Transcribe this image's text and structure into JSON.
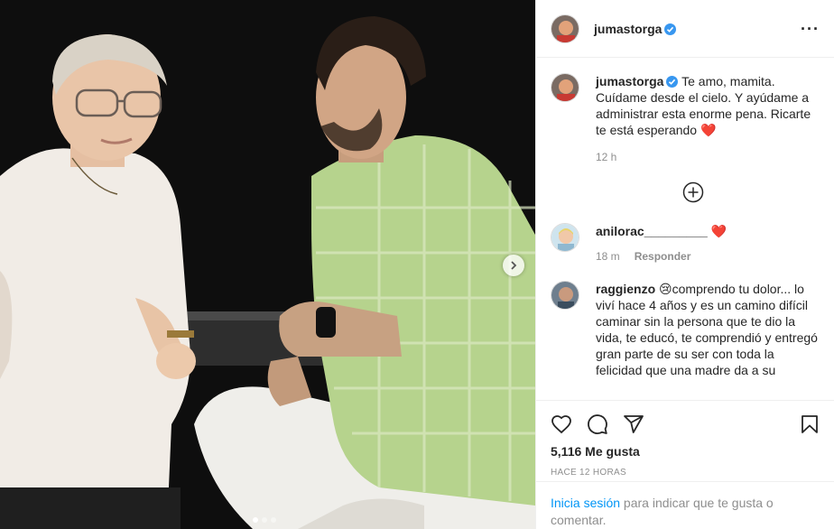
{
  "post": {
    "author": "jumastorga",
    "caption_author": "jumastorga",
    "caption": "Te amo, mamita. Cuídame desde el cielo. Y ayúdame a administrar esta enorme pena. Ricarte te está esperando",
    "caption_emoji": "❤️",
    "caption_age": "12 h",
    "likes": "5,116 Me gusta",
    "timestamp": "HACE 12 HORAS"
  },
  "comments": [
    {
      "author": "anilorac_________",
      "text": "",
      "emoji": "❤️",
      "age": "18 m",
      "reply_label": "Responder"
    },
    {
      "author": "raggienzo",
      "emoji": "😢",
      "text": "comprendo tu dolor... lo viví hace 4 años y es un camino difícil caminar sin la persona que te dio la vida, te educó, te comprendió y entregó gran parte de su ser con toda la felicidad que una madre da a su"
    }
  ],
  "login": {
    "link": "Inicia sesión",
    "text": " para indicar que te gusta o comentar."
  },
  "icons": {
    "more": "more-options-icon",
    "like": "heart-icon",
    "comment": "comment-icon",
    "share": "share-icon",
    "save": "bookmark-icon",
    "next": "chevron-right-icon",
    "load_more": "plus-circle-icon"
  },
  "carousel": {
    "slides": 3,
    "active_index": 0
  },
  "colors": {
    "link": "#0095f6",
    "verified": "#3897f0",
    "secondary_text": "#8e8e8e"
  }
}
